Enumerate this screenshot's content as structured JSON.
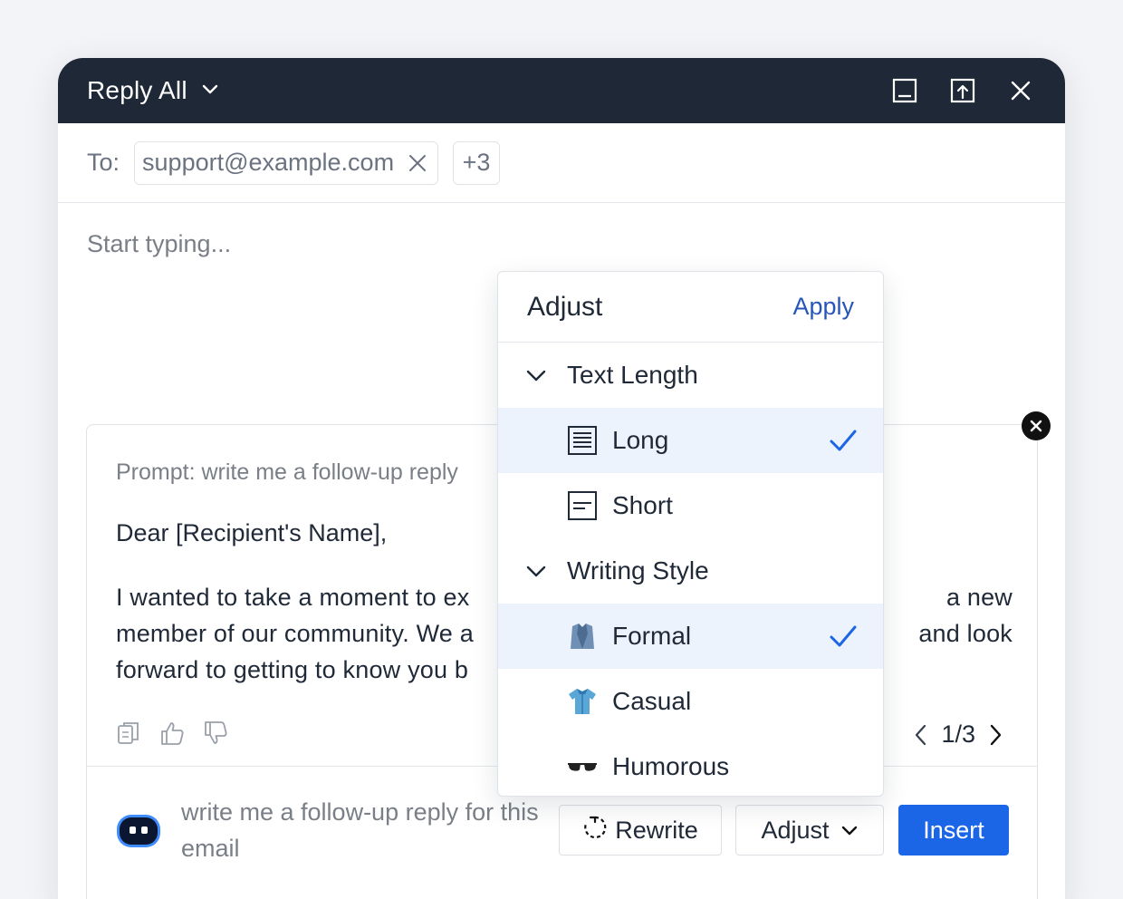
{
  "header": {
    "title": "Reply All",
    "accent": "#1e2836"
  },
  "recipients": {
    "to_label": "To:",
    "email": "support@example.com",
    "more": "+3"
  },
  "editor": {
    "placeholder": "Start typing..."
  },
  "ai_card": {
    "prompt_line": "Prompt: write me a follow-up reply",
    "greeting": "Dear [Recipient's Name],",
    "body_lines": [
      {
        "left": "I wanted to take a moment to ex",
        "right": "a new"
      },
      {
        "left": "member of our community. We a",
        "right": "and look"
      },
      {
        "left": "forward to getting to know you b",
        "right": ""
      }
    ],
    "pager": "1/3",
    "prompt_input": "write me a follow-up reply for this email",
    "rewrite_label": "Rewrite",
    "adjust_label": "Adjust",
    "insert_label": "Insert",
    "insert_color": "#1a66e6"
  },
  "adjust_menu": {
    "title": "Adjust",
    "apply_label": "Apply",
    "sections": [
      {
        "label": "Text Length",
        "options": [
          {
            "label": "Long",
            "icon": "long-text-icon",
            "selected": true
          },
          {
            "label": "Short",
            "icon": "short-text-icon",
            "selected": false
          }
        ]
      },
      {
        "label": "Writing Style",
        "options": [
          {
            "label": "Formal",
            "icon": "suit-icon",
            "selected": true
          },
          {
            "label": "Casual",
            "icon": "tshirt-icon",
            "selected": false
          },
          {
            "label": "Humorous",
            "icon": "sunglasses-icon",
            "selected": false
          }
        ]
      }
    ],
    "selected_bg": "#edf3fc",
    "check_color": "#1a66e6"
  }
}
